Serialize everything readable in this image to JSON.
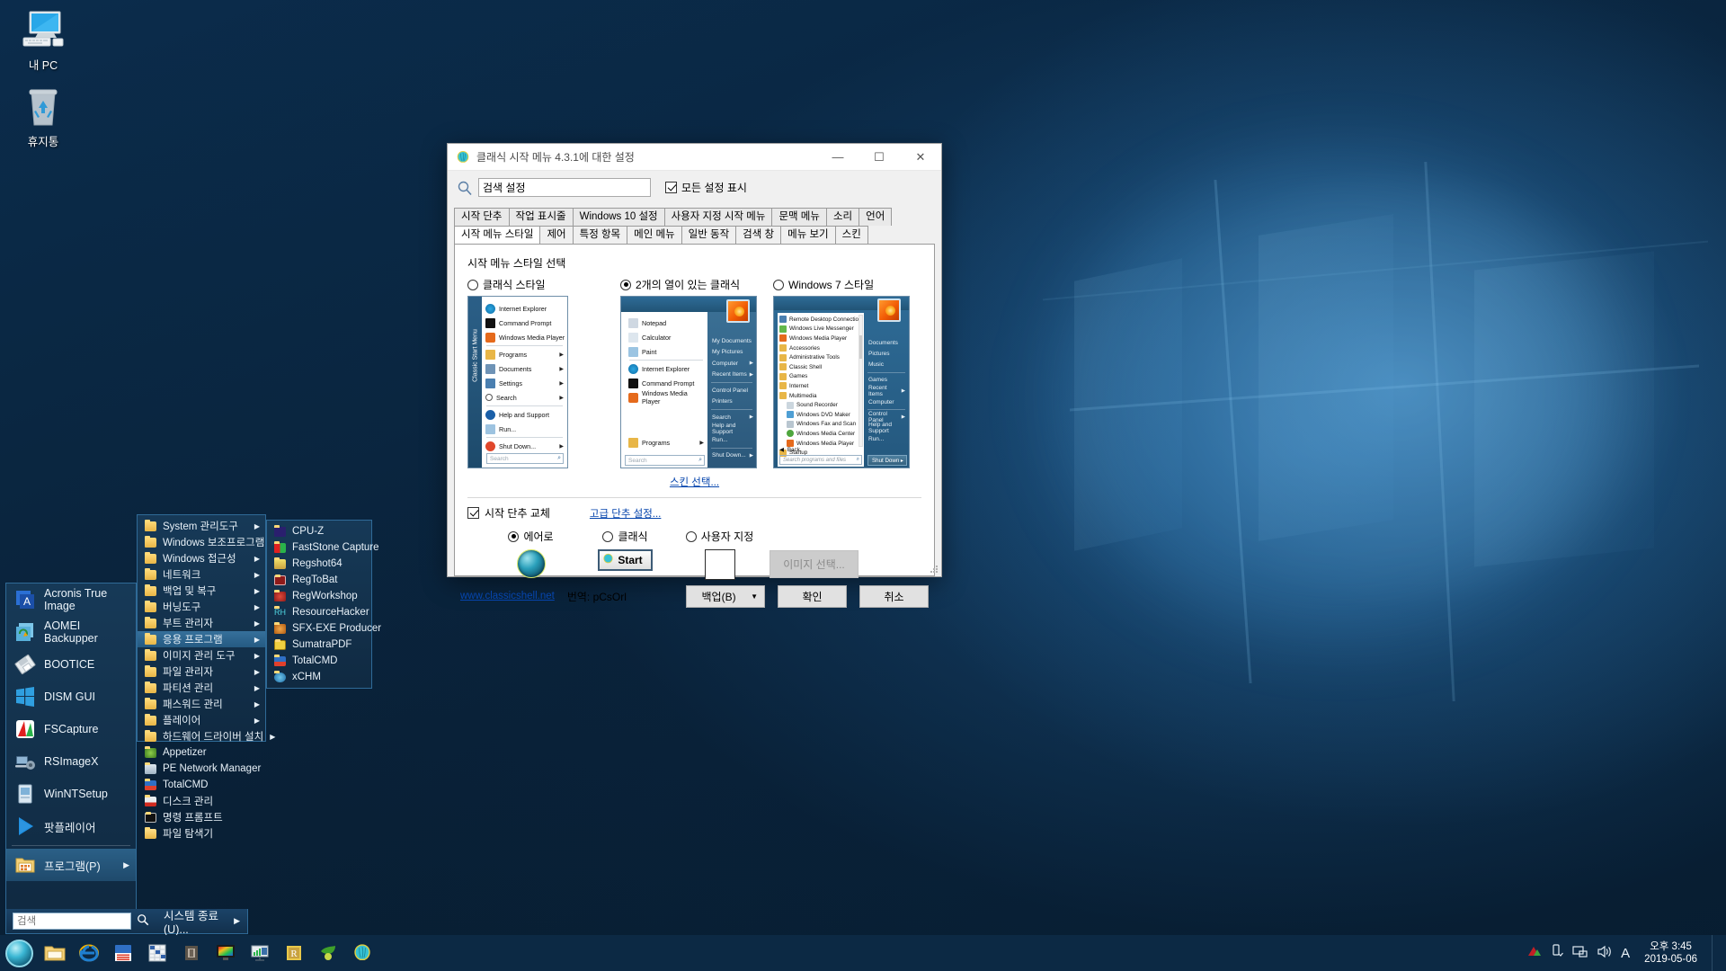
{
  "desktop": {
    "icons": [
      {
        "name": "my-pc",
        "label": "내 PC"
      },
      {
        "name": "recycle-bin",
        "label": "휴지통"
      }
    ]
  },
  "settings_window": {
    "title": "클래식 시작 메뉴 4.3.1에 대한 설정",
    "title_icon": "classic-shell-icon",
    "minimize": "—",
    "maximize": "☐",
    "close": "✕",
    "search": {
      "value": "검색 설정",
      "icon": "search-icon"
    },
    "show_all": {
      "label": "모든 설정 표시",
      "checked": true
    },
    "tabs_row1": [
      "시작 단추",
      "작업 표시줄",
      "Windows 10 설정",
      "사용자 지정 시작 메뉴",
      "문맥 메뉴",
      "소리",
      "언어"
    ],
    "tabs_row2": [
      "시작 메뉴 스타일",
      "제어",
      "특정 항목",
      "메인 메뉴",
      "일반 동작",
      "검색 창",
      "메뉴 보기",
      "스킨"
    ],
    "active_tab": "시작 메뉴 스타일",
    "section_title": "시작 메뉴 스타일 선택",
    "styles": [
      {
        "label": "클래식 스타일",
        "selected": false
      },
      {
        "label": "2개의 열이 있는 클래식",
        "selected": true
      },
      {
        "label": "Windows 7 스타일",
        "selected": false
      }
    ],
    "preview_classic": {
      "sidebar_text": "Classic Start Menu",
      "items": [
        {
          "label": "Internet Explorer",
          "arrow": false
        },
        {
          "label": "Command Prompt",
          "arrow": false
        },
        {
          "label": "Windows Media Player",
          "arrow": false
        },
        {
          "label": "Programs",
          "arrow": true
        },
        {
          "label": "Documents",
          "arrow": true
        },
        {
          "label": "Settings",
          "arrow": true
        },
        {
          "label": "Search",
          "arrow": true
        },
        {
          "label": "Help and Support",
          "arrow": false
        },
        {
          "label": "Run...",
          "arrow": false
        },
        {
          "label": "Shut Down...",
          "arrow": true
        }
      ],
      "search_placeholder": "Search"
    },
    "preview_twocol": {
      "left_items": [
        {
          "label": "Notepad",
          "arrow": false
        },
        {
          "label": "Calculator",
          "arrow": false
        },
        {
          "label": "Paint",
          "arrow": false
        },
        {
          "label": "Internet Explorer",
          "arrow": false
        },
        {
          "label": "Command Prompt",
          "arrow": false
        },
        {
          "label": "Windows Media Player",
          "arrow": false
        }
      ],
      "programs_label": "Programs",
      "search_placeholder": "Search",
      "right_items": [
        {
          "label": "My Documents",
          "arrow": false
        },
        {
          "label": "My Pictures",
          "arrow": false
        },
        {
          "label": "Computer",
          "arrow": true
        },
        {
          "label": "Recent Items",
          "arrow": true
        },
        {
          "label": "Control Panel",
          "arrow": false
        },
        {
          "label": "Printers",
          "arrow": false
        },
        {
          "label": "Search",
          "arrow": true
        },
        {
          "label": "Help and Support",
          "arrow": false
        },
        {
          "label": "Run...",
          "arrow": false
        },
        {
          "label": "Shut Down...",
          "arrow": true
        }
      ]
    },
    "preview_win7": {
      "left_items": [
        {
          "label": "Remote Desktop Connection",
          "indent": 0
        },
        {
          "label": "Windows Live Messenger",
          "indent": 0
        },
        {
          "label": "Windows Media Player",
          "indent": 0
        },
        {
          "label": "Accessories",
          "indent": 0
        },
        {
          "label": "Administrative Tools",
          "indent": 0
        },
        {
          "label": "Classic Shell",
          "indent": 0
        },
        {
          "label": "Games",
          "indent": 0
        },
        {
          "label": "Internet",
          "indent": 0
        },
        {
          "label": "Multimedia",
          "indent": 0
        },
        {
          "label": "Sound Recorder",
          "indent": 1
        },
        {
          "label": "Windows DVD Maker",
          "indent": 1
        },
        {
          "label": "Windows Fax and Scan",
          "indent": 1
        },
        {
          "label": "Windows Media Center",
          "indent": 1
        },
        {
          "label": "Windows Media Player",
          "indent": 1
        },
        {
          "label": "Startup",
          "indent": 0
        }
      ],
      "back_label": "Back",
      "search_placeholder": "Search programs and files",
      "right_items": [
        {
          "label": "Documents",
          "arrow": false
        },
        {
          "label": "Pictures",
          "arrow": false
        },
        {
          "label": "Music",
          "arrow": false
        },
        {
          "label": "Games",
          "arrow": false
        },
        {
          "label": "Recent Items",
          "arrow": true
        },
        {
          "label": "Computer",
          "arrow": false
        },
        {
          "label": "Control Panel",
          "arrow": true
        },
        {
          "label": "Help and Support",
          "arrow": false
        },
        {
          "label": "Run...",
          "arrow": false
        }
      ],
      "shutdown_label": "Shut Down"
    },
    "skin_link": "스킨 선택...",
    "replace_start_button": {
      "label": "시작 단추 교체",
      "checked": true
    },
    "advanced_link": "고급 단추 설정...",
    "button_options": [
      {
        "label": "에어로",
        "selected": true
      },
      {
        "label": "클래식",
        "selected": false
      },
      {
        "label": "사용자 지정",
        "selected": false
      }
    ],
    "classic_start_text": "Start",
    "choose_image_button": "이미지 선택...",
    "footer": {
      "site_link": "www.classicshell.net",
      "translation": "번역: pCsOrl",
      "backup_button": "백업(B)",
      "ok_button": "확인",
      "cancel_button": "취소"
    }
  },
  "start_menu": {
    "items": [
      {
        "label": "Acronis True Image",
        "icon": "acronis-icon",
        "arrow": false
      },
      {
        "label": "AOMEI Backupper",
        "icon": "aomei-icon",
        "arrow": false
      },
      {
        "label": "BOOTICE",
        "icon": "bootice-icon",
        "arrow": false
      },
      {
        "label": "DISM GUI",
        "icon": "dism-gui-icon",
        "arrow": false
      },
      {
        "label": "FSCapture",
        "icon": "fscapture-icon",
        "arrow": false
      },
      {
        "label": "RSImageX",
        "icon": "rsimagex-icon",
        "arrow": false
      },
      {
        "label": "WinNTSetup",
        "icon": "winntsetup-icon",
        "arrow": false
      },
      {
        "label": "팟플레이어",
        "icon": "potplayer-icon",
        "arrow": false
      }
    ],
    "programs": {
      "label": "프로그램(P)",
      "icon": "programs-folder-icon",
      "arrow": "▶"
    },
    "search_placeholder": "검색",
    "search_icon": "search-icon",
    "shutdown": {
      "label": "시스템 종료(U)...",
      "arrow": "▶"
    }
  },
  "submenu_programs": {
    "items": [
      {
        "label": "System 관리도구",
        "arrow": true,
        "icon": "folder-icon"
      },
      {
        "label": "Windows 보조프로그램",
        "arrow": true,
        "icon": "folder-icon"
      },
      {
        "label": "Windows 접근성",
        "arrow": true,
        "icon": "folder-icon"
      },
      {
        "label": "네트워크",
        "arrow": true,
        "icon": "folder-icon"
      },
      {
        "label": "백업 및 복구",
        "arrow": true,
        "icon": "folder-icon"
      },
      {
        "label": "버닝도구",
        "arrow": true,
        "icon": "folder-icon"
      },
      {
        "label": "부트 관리자",
        "arrow": true,
        "icon": "folder-icon"
      },
      {
        "label": "응용 프로그램",
        "arrow": true,
        "icon": "folder-icon",
        "selected": true
      },
      {
        "label": "이미지 관리 도구",
        "arrow": true,
        "icon": "folder-icon"
      },
      {
        "label": "파일 관리자",
        "arrow": true,
        "icon": "folder-icon"
      },
      {
        "label": "파티션 관리",
        "arrow": true,
        "icon": "folder-icon"
      },
      {
        "label": "패스워드 관리",
        "arrow": true,
        "icon": "folder-icon"
      },
      {
        "label": "플레이어",
        "arrow": true,
        "icon": "folder-icon"
      },
      {
        "label": "하드웨어 드라이버 설치",
        "arrow": true,
        "icon": "folder-icon"
      },
      {
        "label": "Appetizer",
        "arrow": false,
        "icon": "appetizer-icon"
      },
      {
        "label": "PE Network Manager",
        "arrow": false,
        "icon": "pe-network-manager-icon"
      },
      {
        "label": "TotalCMD",
        "arrow": false,
        "icon": "totalcmd-icon"
      },
      {
        "label": "디스크 관리",
        "arrow": false,
        "icon": "disk-management-icon"
      },
      {
        "label": "명령 프롬프트",
        "arrow": false,
        "icon": "command-prompt-icon"
      },
      {
        "label": "파일 탐색기",
        "arrow": false,
        "icon": "file-explorer-icon"
      }
    ]
  },
  "submenu_apps": {
    "items": [
      {
        "label": "CPU-Z",
        "icon": "cpuz-icon"
      },
      {
        "label": "FastStone Capture",
        "icon": "faststone-icon"
      },
      {
        "label": "Regshot64",
        "icon": "regshot-icon"
      },
      {
        "label": "RegToBat",
        "icon": "regtobat-icon"
      },
      {
        "label": "RegWorkshop",
        "icon": "regworkshop-icon"
      },
      {
        "label": "ResourceHacker",
        "icon": "resourcehacker-icon"
      },
      {
        "label": "SFX-EXE Producer",
        "icon": "sfx-exe-icon"
      },
      {
        "label": "SumatraPDF",
        "icon": "sumatrapdf-icon"
      },
      {
        "label": "TotalCMD",
        "icon": "totalcmd-icon"
      },
      {
        "label": "xCHM",
        "icon": "xchm-icon"
      }
    ]
  },
  "taskbar": {
    "start_icon": "classic-shell-start-orb",
    "pinned": [
      "file-explorer-icon",
      "internet-explorer-icon",
      "totalcmd-icon",
      "spreadsheet-icon",
      "imaging-tool-icon",
      "display-color-icon",
      "network-monitor-icon",
      "regworkshop-icon",
      "leaf-app-icon",
      "classic-shell-icon"
    ],
    "tray": {
      "icons": [
        "nvidia-icon",
        "usb-eject-icon",
        "network-icon",
        "volume-icon",
        "ime-icon"
      ],
      "ime_label": "A",
      "time": "오후 3:45",
      "date": "2019-05-06"
    }
  }
}
